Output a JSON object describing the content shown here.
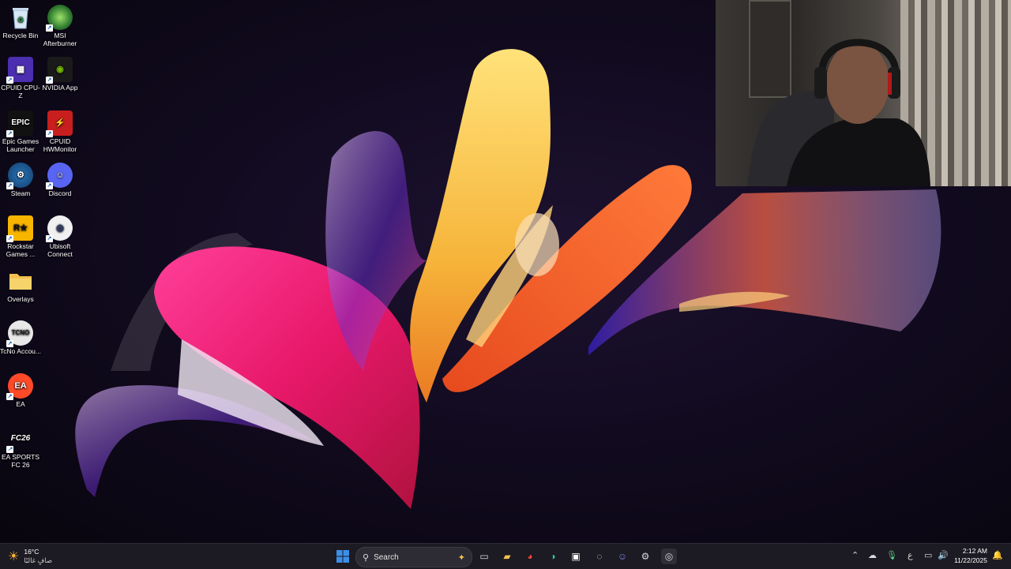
{
  "desktop": {
    "icons": [
      {
        "label": "Recycle Bin"
      },
      {
        "label": "MSI Afterburner"
      },
      {
        "label": "CPUID CPU-Z"
      },
      {
        "label": "NVIDIA App"
      },
      {
        "label": "Epic Games Launcher"
      },
      {
        "label": "CPUID HWMonitor"
      },
      {
        "label": "Steam"
      },
      {
        "label": "Discord"
      },
      {
        "label": "Rockstar Games ..."
      },
      {
        "label": "Ubisoft Connect"
      },
      {
        "label": "Overlays"
      },
      {
        "label": "TcNo Accou..."
      },
      {
        "label": "EA"
      },
      {
        "label": "EA SPORTS FC 26"
      }
    ]
  },
  "taskbar": {
    "weather": {
      "temp": "16°C",
      "condition": "صافٍ غالبًا"
    },
    "search_placeholder": "Search",
    "language_indicator": "ع",
    "clock": {
      "time": "2:12 AM",
      "date": "11/22/2025"
    }
  },
  "colors": {
    "taskbar_bg": "#1c1a22",
    "windows_blue": "#3b8fe8",
    "discord": "#5865f2",
    "nvidia": "#76b900"
  }
}
